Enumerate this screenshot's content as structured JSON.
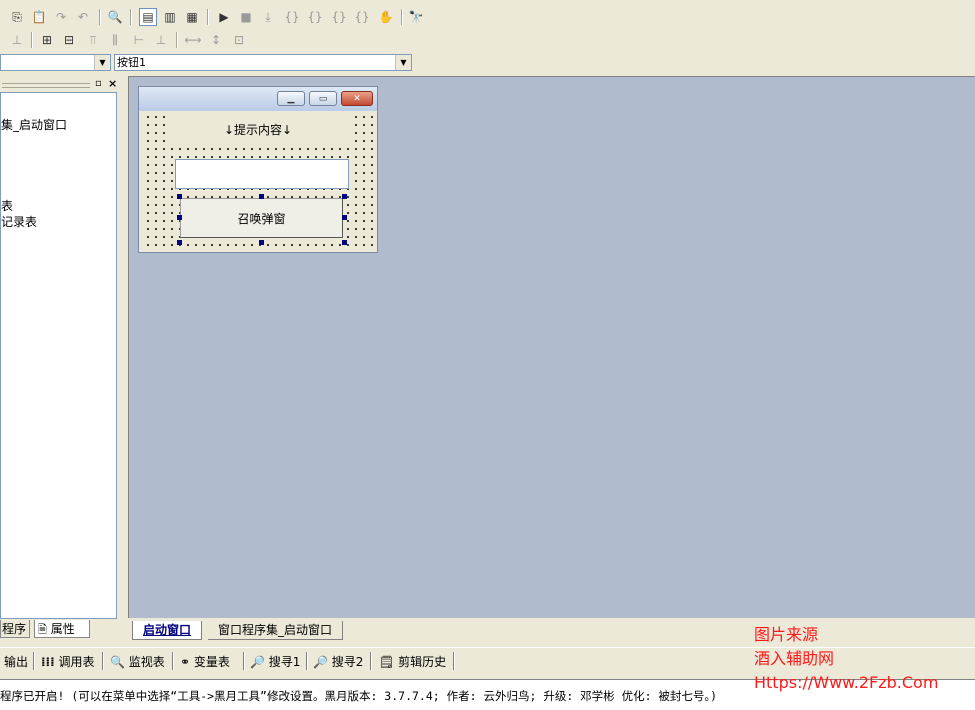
{
  "toolbar1": {
    "icons": [
      "copy-icon",
      "paste-icon",
      "redo-icon",
      "undo-icon",
      "find-icon",
      "layout1-icon",
      "layout2-icon",
      "layout3-icon",
      "run-icon",
      "stop-icon",
      "step-icon",
      "step-into-icon",
      "step-over-icon",
      "step-out-icon",
      "run-to-cursor-icon",
      "hand-icon",
      "binoculars-icon"
    ]
  },
  "toolbar2": {
    "icons": [
      "align-tree-icon",
      "center-horizontal-icon",
      "center-vertical-icon",
      "align-top-icon",
      "align-middle-icon",
      "align-bottom-icon",
      "distribute-icon",
      "same-width-icon",
      "same-height-icon",
      "same-size-icon"
    ]
  },
  "combos": {
    "object_combo": "",
    "event_combo": "按钮1"
  },
  "left_panel": {
    "tree_items": [
      "集_启动窗口",
      "表",
      "记录表"
    ],
    "tabs": [
      "程序",
      "属性"
    ]
  },
  "form": {
    "label_text": "↓提示内容↓",
    "input_value": "",
    "button_label": "召唤弹窗"
  },
  "doc_tabs": [
    "启动窗口",
    "窗口程序集_启动窗口"
  ],
  "output_tabs": [
    "输出",
    "调用表",
    "监视表",
    "变量表",
    "搜寻1",
    "搜寻2",
    "剪辑历史"
  ],
  "status_text": "程序已开启! (可以在菜单中选择“工具->黑月工具”修改设置。黑月版本: 3.7.7.4; 作者: 云外归鸟; 升级: 邓学彬 优化: 被封七号。)",
  "watermark": {
    "line1": "图片来源",
    "line2": "酒入辅助网",
    "line3": "Https://Www.2Fzb.Com"
  },
  "colors": {
    "workspace": "#b0bccd",
    "chrome": "#ece9d8",
    "selection_handle": "#000080",
    "watermark": "#ff1a1a"
  }
}
